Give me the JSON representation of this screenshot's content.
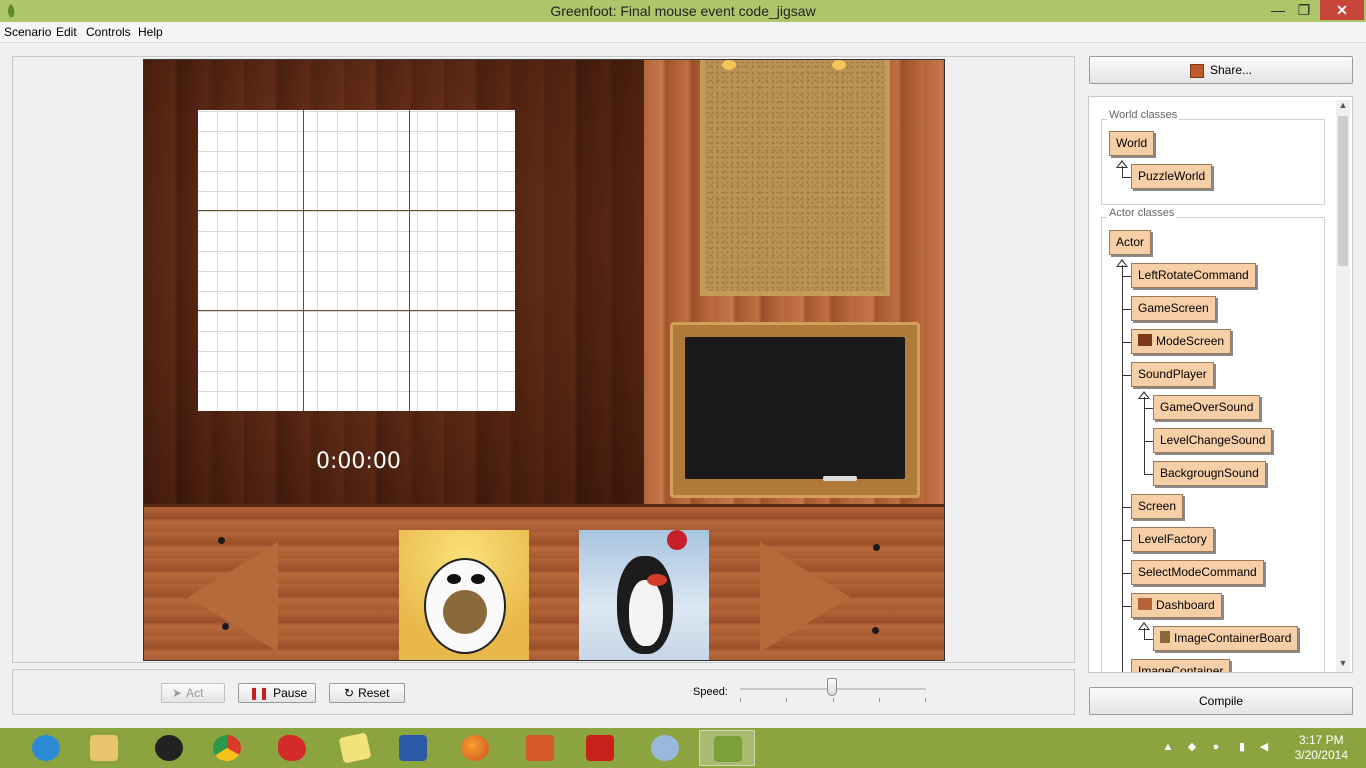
{
  "window": {
    "title": "Greenfoot: Final mouse event code_jigsaw",
    "minimize_glyph": "—",
    "restore_glyph": "❐",
    "close_glyph": "✕"
  },
  "menu": [
    "Scenario",
    "Edit",
    "Controls",
    "Help"
  ],
  "world": {
    "timer": "0:00:00"
  },
  "controls": {
    "act_label": "Act",
    "pause_label": "Pause",
    "reset_label": "Reset",
    "speed_label": "Speed:",
    "speed_fraction": 0.5
  },
  "share_label": "Share...",
  "compile_label": "Compile",
  "class_browser": {
    "world_group_label": "World classes",
    "actor_group_label": "Actor classes",
    "world_classes": [
      "World",
      "PuzzleWorld"
    ],
    "actor_classes": [
      "Actor",
      "LeftRotateCommand",
      "GameScreen",
      "ModeScreen",
      "SoundPlayer",
      "GameOverSound",
      "LevelChangeSound",
      "BackgrougnSound",
      "Screen",
      "LevelFactory",
      "SelectModeCommand",
      "Dashboard",
      "ImageContainerBoard",
      "ImageContainer"
    ]
  },
  "taskbar": {
    "clock_time": "3:17 PM",
    "clock_date": "3/20/2014",
    "apps": [
      "internet-explorer",
      "file-explorer",
      "media-player",
      "chrome",
      "paint-app",
      "sticky-notes",
      "word",
      "firefox",
      "powerpoint",
      "acrobat",
      "app-blue",
      "greenfoot"
    ]
  },
  "colors": {
    "titlebar": "#aec66a",
    "taskbar": "#8ca440",
    "class_box": "#f6cfa6"
  }
}
